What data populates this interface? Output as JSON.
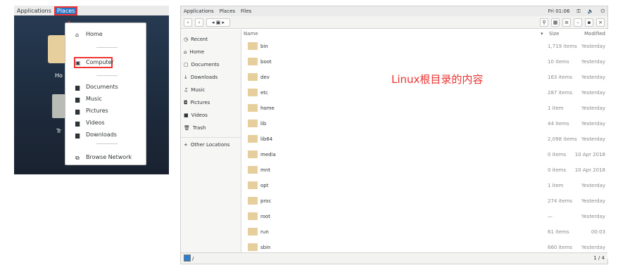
{
  "left_panel": {
    "topbar": {
      "applications": "Applications",
      "places": "Places"
    },
    "desktop_labels": {
      "home": "Ho",
      "trash": "Tr"
    },
    "menu": {
      "items": [
        {
          "label": "Home",
          "icon": "home-icon"
        },
        {
          "label": "Computer",
          "icon": "computer-icon"
        },
        {
          "label": "Documents",
          "icon": "folder-icon"
        },
        {
          "label": "Music",
          "icon": "folder-icon"
        },
        {
          "label": "Pictures",
          "icon": "folder-icon"
        },
        {
          "label": "Videos",
          "icon": "folder-icon"
        },
        {
          "label": "Downloads",
          "icon": "folder-icon"
        },
        {
          "label": "Browse Network",
          "icon": "network-icon"
        }
      ]
    }
  },
  "right_panel": {
    "topbar": {
      "applications": "Applications",
      "places": "Places",
      "files": "Files",
      "time": "Fri 01:06"
    },
    "sidebar": [
      "Recent",
      "Home",
      "Documents",
      "Downloads",
      "Music",
      "Pictures",
      "Videos",
      "Trash",
      "Other Locations"
    ],
    "columns": {
      "name": "Name",
      "size": "Size",
      "modified": "Modified"
    },
    "note": "Linux根目录的内容",
    "rows": [
      {
        "name": "bin",
        "size": "1,719 items",
        "mod": "Yesterday"
      },
      {
        "name": "boot",
        "size": "10 items",
        "mod": "Yesterday"
      },
      {
        "name": "dev",
        "size": "163 items",
        "mod": "Yesterday"
      },
      {
        "name": "etc",
        "size": "287 items",
        "mod": "Yesterday"
      },
      {
        "name": "home",
        "size": "1 item",
        "mod": "Yesterday"
      },
      {
        "name": "lib",
        "size": "44 items",
        "mod": "Yesterday"
      },
      {
        "name": "lib64",
        "size": "2,098 items",
        "mod": "Yesterday"
      },
      {
        "name": "media",
        "size": "0 items",
        "mod": "10 Apr 2018"
      },
      {
        "name": "mnt",
        "size": "0 items",
        "mod": "10 Apr 2018"
      },
      {
        "name": "opt",
        "size": "1 item",
        "mod": "Yesterday"
      },
      {
        "name": "proc",
        "size": "274 items",
        "mod": "Yesterday"
      },
      {
        "name": "root",
        "size": "—",
        "mod": "Yesterday"
      },
      {
        "name": "run",
        "size": "61 items",
        "mod": "00:03"
      },
      {
        "name": "sbin",
        "size": "660 items",
        "mod": "Yesterday"
      }
    ],
    "status": {
      "path": "/",
      "page": "1 / 4"
    }
  }
}
